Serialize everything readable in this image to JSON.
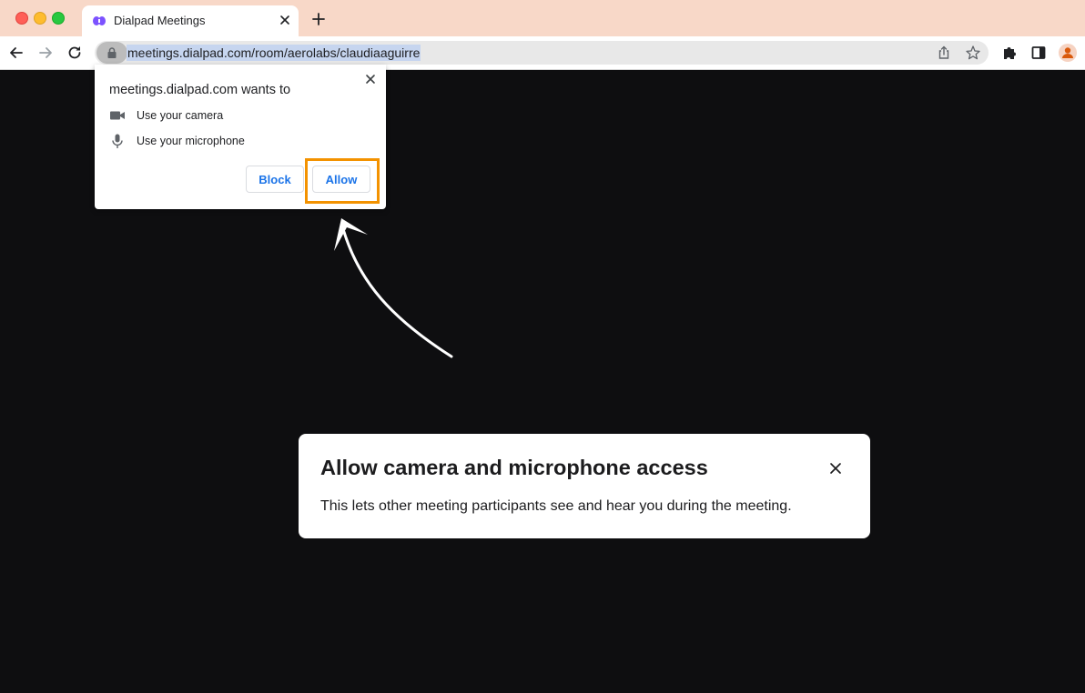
{
  "browser": {
    "tab": {
      "title": "Dialpad Meetings",
      "favicon": "dialpad-logo-icon"
    },
    "address_bar": {
      "url": "meetings.dialpad.com/room/aerolabs/claudiaaguirre"
    },
    "colors": {
      "tabbar_bg": "#f8d8c8",
      "favicon": "#7c52ff"
    }
  },
  "permission_prompt": {
    "title": "meetings.dialpad.com wants to",
    "items": [
      {
        "icon": "camera-icon",
        "label": "Use your camera"
      },
      {
        "icon": "microphone-icon",
        "label": "Use your microphone"
      }
    ],
    "block_label": "Block",
    "allow_label": "Allow",
    "highlight_color": "#f39200",
    "button_text_color": "#1a73e8"
  },
  "modal": {
    "title": "Allow camera and microphone access",
    "body": "This lets other meeting participants see and hear you during the meeting."
  },
  "page": {
    "background": "#0e0e10"
  }
}
